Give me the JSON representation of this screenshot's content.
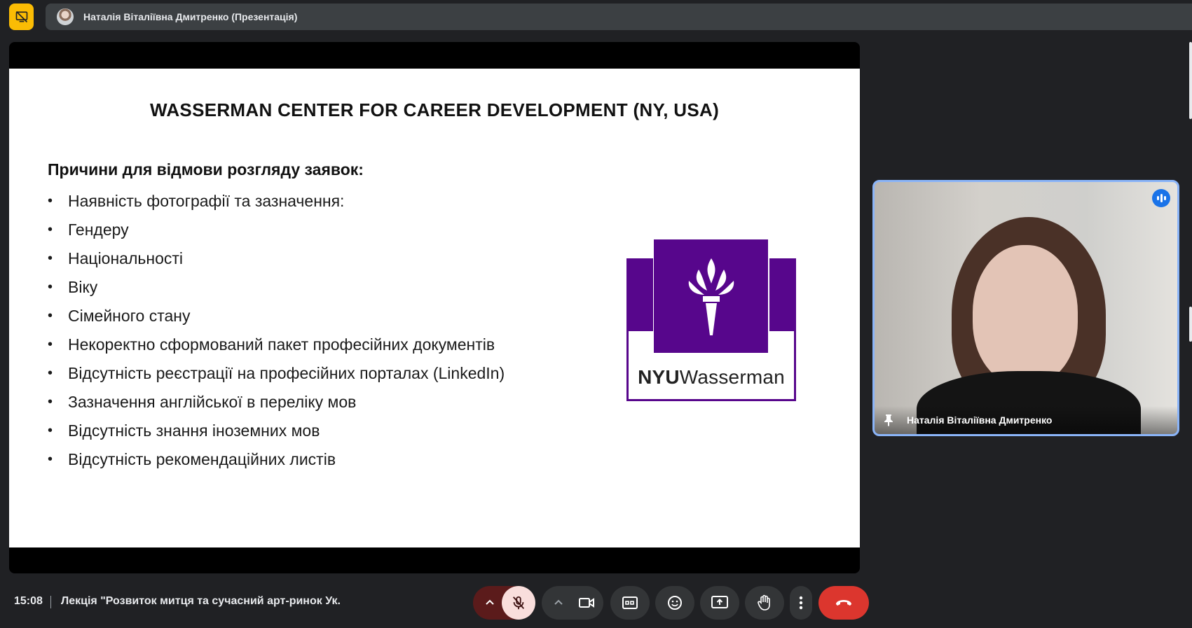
{
  "header": {
    "presenter_label": "Наталія Віталіївна Дмитренко (Презентація)"
  },
  "slide": {
    "title": "WASSERMAN CENTER FOR CAREER DEVELOPMENT (NY, USA)",
    "heading": "Причини для відмови розгляду заявок:",
    "bullet_symbol": "•",
    "bullets": [
      "Наявність фотографії та зазначення:",
      "Гендеру",
      "Національності",
      "Віку",
      "Сімейного стану",
      "Некоректно сформований пакет професійних документів",
      "Відсутність реєстрації на професійних порталах (LinkedIn)",
      "Зазначення англійської в переліку мов",
      "Відсутність знання іноземних мов",
      "Відсутність рекомендаційних листів"
    ],
    "logo": {
      "text_bold": "NYU",
      "text_regular": "Wasserman",
      "color": "#57068c"
    }
  },
  "participant": {
    "name": "Наталія Віталіївна Дмитренко",
    "border_color": "#8ab4f8"
  },
  "footer": {
    "time": "15:08",
    "meeting_title": "Лекція \"Розвиток митця та сучасний арт-ринок Ук..."
  },
  "controls": {
    "mic_options": "chevron-up-icon",
    "mic": "mic-off-icon",
    "camera_options": "chevron-up-icon",
    "camera": "videocam-icon",
    "captions": "closed-caption-icon",
    "reactions": "emoji-icon",
    "present": "present-screen-icon",
    "raise_hand": "hand-icon",
    "more": "more-vert-icon",
    "leave": "call-end-icon",
    "leave_color": "#dc362e"
  }
}
